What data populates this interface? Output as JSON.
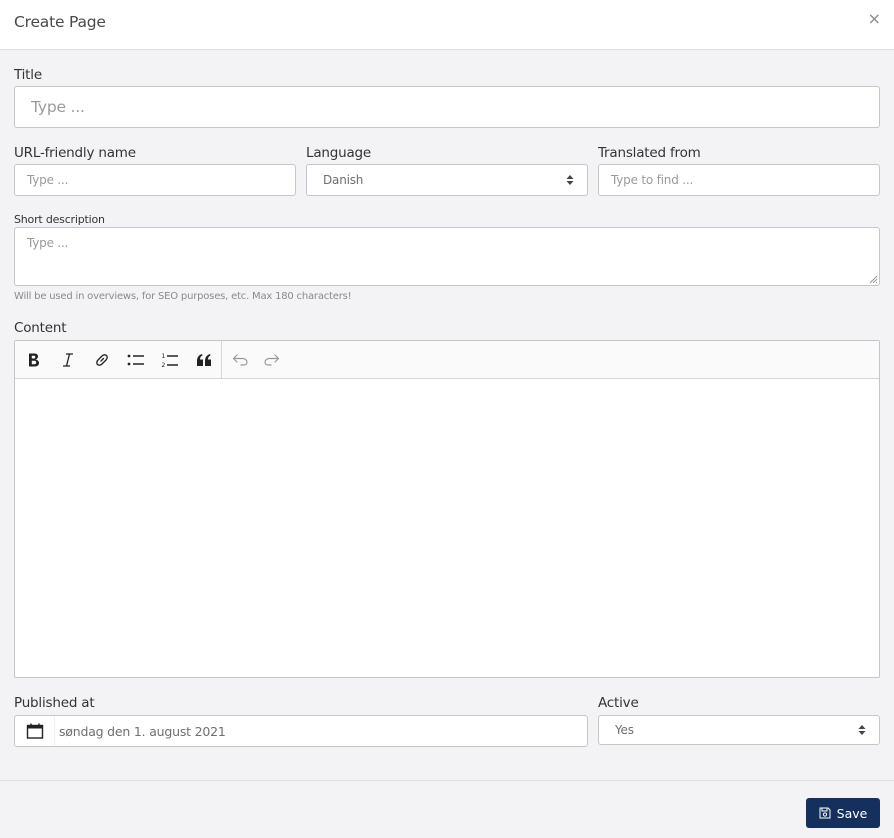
{
  "header": {
    "title": "Create Page",
    "close_icon": "×"
  },
  "form": {
    "title": {
      "label": "Title",
      "placeholder": "Type ..."
    },
    "url_name": {
      "label": "URL-friendly name",
      "placeholder": "Type ..."
    },
    "language": {
      "label": "Language",
      "selected": "Danish"
    },
    "translated_from": {
      "label": "Translated from",
      "placeholder": "Type to find ..."
    },
    "short_description": {
      "label": "Short description",
      "placeholder": "Type ...",
      "help": "Will be used in overviews, for SEO purposes, etc. Max 180 characters!"
    },
    "content": {
      "label": "Content",
      "toolbar": [
        {
          "name": "bold",
          "icon": "bold-icon"
        },
        {
          "name": "italic",
          "icon": "italic-icon"
        },
        {
          "name": "link",
          "icon": "link-icon"
        },
        {
          "name": "bullet-list",
          "icon": "bullet-list-icon"
        },
        {
          "name": "numbered-list",
          "icon": "numbered-list-icon"
        },
        {
          "name": "blockquote",
          "icon": "quote-icon"
        },
        {
          "name": "undo",
          "icon": "undo-icon"
        },
        {
          "name": "redo",
          "icon": "redo-icon"
        }
      ]
    },
    "published_at": {
      "label": "Published at",
      "value": "søndag den 1. august 2021"
    },
    "active": {
      "label": "Active",
      "selected": "Yes"
    }
  },
  "footer": {
    "save_label": "Save"
  },
  "colors": {
    "primary": "#16305e",
    "background": "#f3f3f5",
    "border": "#c3c6cc"
  }
}
